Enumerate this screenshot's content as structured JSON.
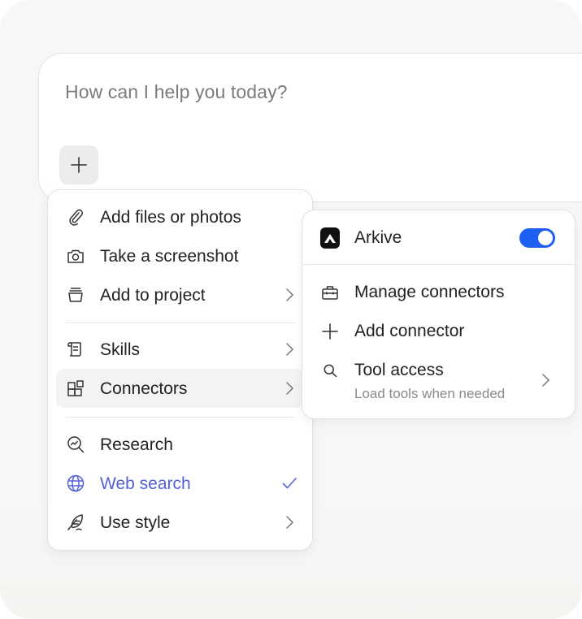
{
  "composer": {
    "placeholder": "How can I help you today?",
    "plus_icon": "plus-icon"
  },
  "menu": {
    "items": [
      {
        "label": "Add files or photos",
        "icon": "paperclip-icon"
      },
      {
        "label": "Take a screenshot",
        "icon": "camera-icon"
      },
      {
        "label": "Add to project",
        "icon": "project-icon"
      },
      {
        "label": "Skills",
        "icon": "scroll-icon"
      },
      {
        "label": "Connectors",
        "icon": "connectors-icon"
      },
      {
        "label": "Research",
        "icon": "research-icon"
      },
      {
        "label": "Web search",
        "icon": "globe-icon",
        "checked": true
      },
      {
        "label": "Use style",
        "icon": "feather-icon"
      }
    ],
    "accent_color": "#5461d6"
  },
  "submenu": {
    "connector": {
      "name": "Arkive",
      "enabled": true,
      "toggle_color": "#1d5ff0"
    },
    "items": [
      {
        "label": "Manage connectors",
        "icon": "toolbox-icon"
      },
      {
        "label": "Add connector",
        "icon": "plus-icon"
      },
      {
        "label": "Tool access",
        "sublabel": "Load tools when needed",
        "icon": "search-icon"
      }
    ]
  }
}
